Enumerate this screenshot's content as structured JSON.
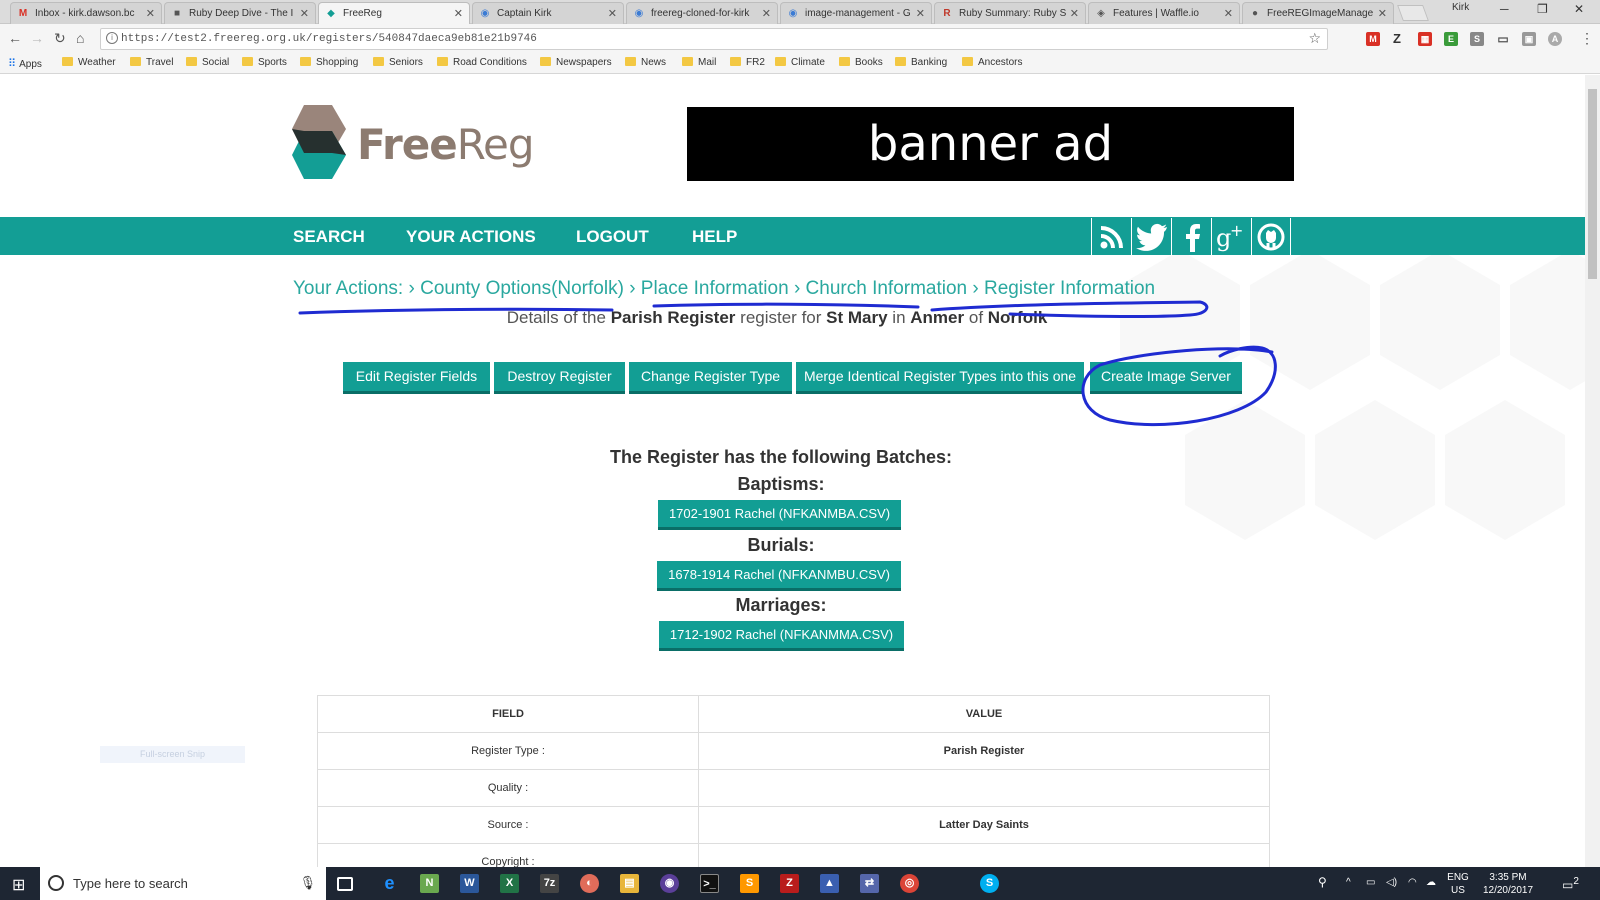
{
  "browser": {
    "tabs": [
      {
        "icon": "M",
        "title": "Inbox - kirk.dawson.bc"
      },
      {
        "icon": "■",
        "title": "Ruby Deep Dive - The I"
      },
      {
        "icon": "◆",
        "title": "FreeReg"
      },
      {
        "icon": "◉",
        "title": "Captain Kirk"
      },
      {
        "icon": "◉",
        "title": "freereg-cloned-for-kirk"
      },
      {
        "icon": "◉",
        "title": "image-management - G"
      },
      {
        "icon": "R",
        "title": "Ruby Summary: Ruby S"
      },
      {
        "icon": "◈",
        "title": "Features | Waffle.io"
      },
      {
        "icon": "●",
        "title": "FreeREGImageManage"
      }
    ],
    "close_glyph": "✕",
    "user_label": "Kirk",
    "url": "https://test2.freereg.org.uk/registers/540847daeca9eb81e21b9746",
    "bookmarks": [
      "Apps",
      "Weather",
      "Travel",
      "Social",
      "Sports",
      "Shopping",
      "Seniors",
      "Road Conditions",
      "Newspapers",
      "News",
      "Mail",
      "FR2",
      "Climate",
      "Books",
      "Banking",
      "Ancestors"
    ]
  },
  "site": {
    "logo_bold": "Free",
    "logo_rest": "Reg",
    "banner": "banner ad",
    "nav": [
      "SEARCH",
      "YOUR ACTIONS",
      "LOGOUT",
      "HELP"
    ],
    "social_icons": [
      "rss-icon",
      "twitter-icon",
      "facebook-icon",
      "google-plus-icon",
      "github-icon"
    ],
    "breadcrumbs": [
      "Your Actions:",
      "County Options(Norfolk)",
      "Place Information",
      "Church Information",
      "Register Information"
    ],
    "details": {
      "p1": "Details of the",
      "register_type": "Parish Register",
      "p2": "register for",
      "church": "St Mary",
      "p3": "in",
      "place": "Anmer",
      "p4": "of",
      "county": "Norfolk"
    },
    "actions": [
      "Edit Register Fields",
      "Destroy Register",
      "Change Register Type",
      "Merge Identical Register Types into this one",
      "Create Image Server"
    ],
    "batches_heading": "The Register has the following Batches:",
    "batch_groups": [
      {
        "label": "Baptisms:",
        "file": "1702-1901 Rachel (NFKANMBA.CSV)"
      },
      {
        "label": "Burials:",
        "file": "1678-1914 Rachel (NFKANMBU.CSV)"
      },
      {
        "label": "Marriages:",
        "file": "1712-1902 Rachel (NFKANMMA.CSV)"
      }
    ],
    "table": {
      "headers": [
        "FIELD",
        "VALUE"
      ],
      "rows": [
        {
          "field": "Register Type :",
          "value": "Parish Register"
        },
        {
          "field": "Quality :",
          "value": ""
        },
        {
          "field": "Source :",
          "value": "Latter Day Saints"
        },
        {
          "field": "Copyright :",
          "value": ""
        }
      ]
    },
    "snip_label": "Full-screen Snip"
  },
  "taskbar": {
    "search_placeholder": "Type here to search",
    "lang": "ENG",
    "region": "US",
    "time": "3:35 PM",
    "date": "12/20/2017",
    "notifications": "2"
  },
  "colors": {
    "teal": "#139e95",
    "annotation": "#1f2bd1"
  }
}
